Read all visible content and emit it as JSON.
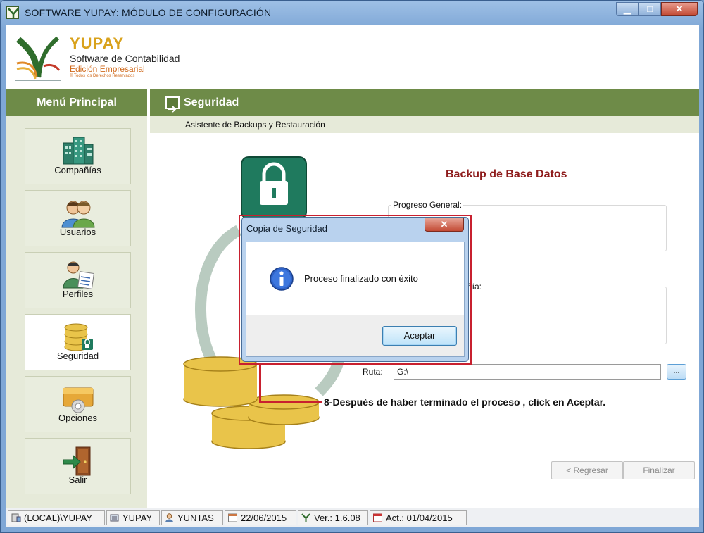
{
  "window": {
    "title": "SOFTWARE YUPAY: MÓDULO DE CONFIGURACIÓN",
    "min": "▁",
    "max": "□",
    "close": "✕"
  },
  "brand": {
    "name": "YUPAY",
    "subtitle": "Software de Contabilidad",
    "edition": "Edición Empresarial",
    "rights": "© Todos los Derechos Reservados"
  },
  "sidebar": {
    "title": "Menú Principal",
    "items": [
      {
        "label": "Compañías",
        "icon": "buildings-icon"
      },
      {
        "label": "Usuarios",
        "icon": "users-icon"
      },
      {
        "label": "Perfiles",
        "icon": "profile-icon"
      },
      {
        "label": "Seguridad",
        "icon": "database-lock-icon",
        "active": true
      },
      {
        "label": "Opciones",
        "icon": "options-icon"
      },
      {
        "label": "Salir",
        "icon": "exit-door-icon"
      }
    ]
  },
  "main": {
    "section_title": "Seguridad",
    "subtitle": "Asistente de Backups y Restauración",
    "backup_title": "Backup de Base Datos",
    "progress_label": "Progreso General:",
    "company_label_partial": "ñía:",
    "ruta_label": "Ruta:",
    "ruta_value": "G:\\",
    "browse_label": "...",
    "back_button": "< Regresar",
    "finish_button": "Finalizar"
  },
  "annotation": {
    "text": "8-Después de haber terminado el proceso , click en Aceptar.",
    "color": "#c8202f"
  },
  "dialog": {
    "title": "Copia de Seguridad",
    "close": "✕",
    "message": "Proceso finalizado con éxito",
    "ok_button": "Aceptar"
  },
  "statusbar": {
    "server": "(LOCAL)\\YUPAY",
    "database": "YUPAY",
    "user": "YUNTAS",
    "date": "22/06/2015",
    "version": "Ver.: 1.6.08",
    "updated": "Act.: 01/04/2015"
  },
  "colors": {
    "green": "#6e8b48",
    "sidebar_bg": "#e6ead9",
    "title_red": "#8e1c1c",
    "accent_gold": "#d9a21c"
  }
}
